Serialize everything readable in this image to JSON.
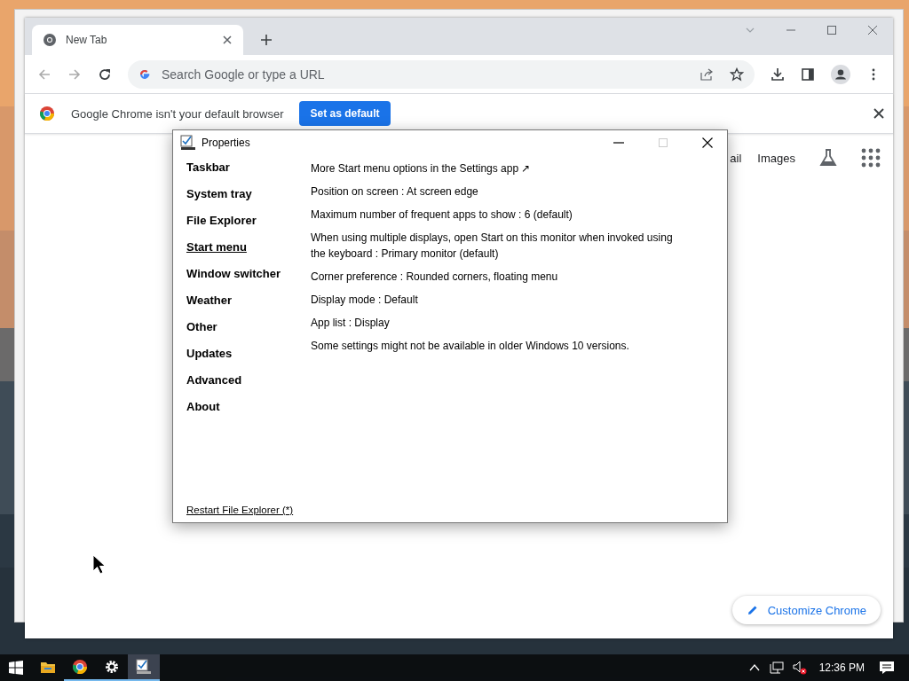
{
  "browser": {
    "tabs": [
      {
        "title": "New Tab",
        "selected": true
      }
    ],
    "omnibox": {
      "placeholder": "Search Google or type a URL"
    },
    "infobar": {
      "message": "Google Chrome isn't your default browser",
      "button": "Set as default"
    },
    "ntp_links": [
      "ail",
      "Images"
    ],
    "customize_button": "Customize Chrome"
  },
  "dialog": {
    "title": "Properties",
    "nav": [
      {
        "label": "Taskbar",
        "selected": false
      },
      {
        "label": "System tray",
        "selected": false
      },
      {
        "label": "File Explorer",
        "selected": false
      },
      {
        "label": "Start menu",
        "selected": true
      },
      {
        "label": "Window switcher",
        "selected": false
      },
      {
        "label": "Weather",
        "selected": false
      },
      {
        "label": "Other",
        "selected": false
      },
      {
        "label": "Updates",
        "selected": false
      },
      {
        "label": "Advanced",
        "selected": false
      },
      {
        "label": "About",
        "selected": false
      }
    ],
    "settings": [
      "More Start menu options in the Settings app ↗",
      "Position on screen : At screen edge",
      "Maximum number of frequent apps to show : 6 (default)",
      "When using multiple displays, open Start on this monitor when invoked using the keyboard : Primary monitor (default)",
      "Corner preference : Rounded corners, floating menu",
      "Display mode : Default",
      "App list : Display",
      "Some settings might not be available in older Windows 10 versions."
    ],
    "footer_link": "Restart File Explorer (*)"
  },
  "taskbar": {
    "apps": [
      {
        "kind": "files",
        "running": false,
        "selected": false
      },
      {
        "kind": "chrome",
        "running": true,
        "selected": false
      },
      {
        "kind": "settings",
        "running": true,
        "selected": false
      },
      {
        "kind": "properties",
        "running": true,
        "selected": true
      }
    ],
    "clock": "12:36 PM"
  }
}
